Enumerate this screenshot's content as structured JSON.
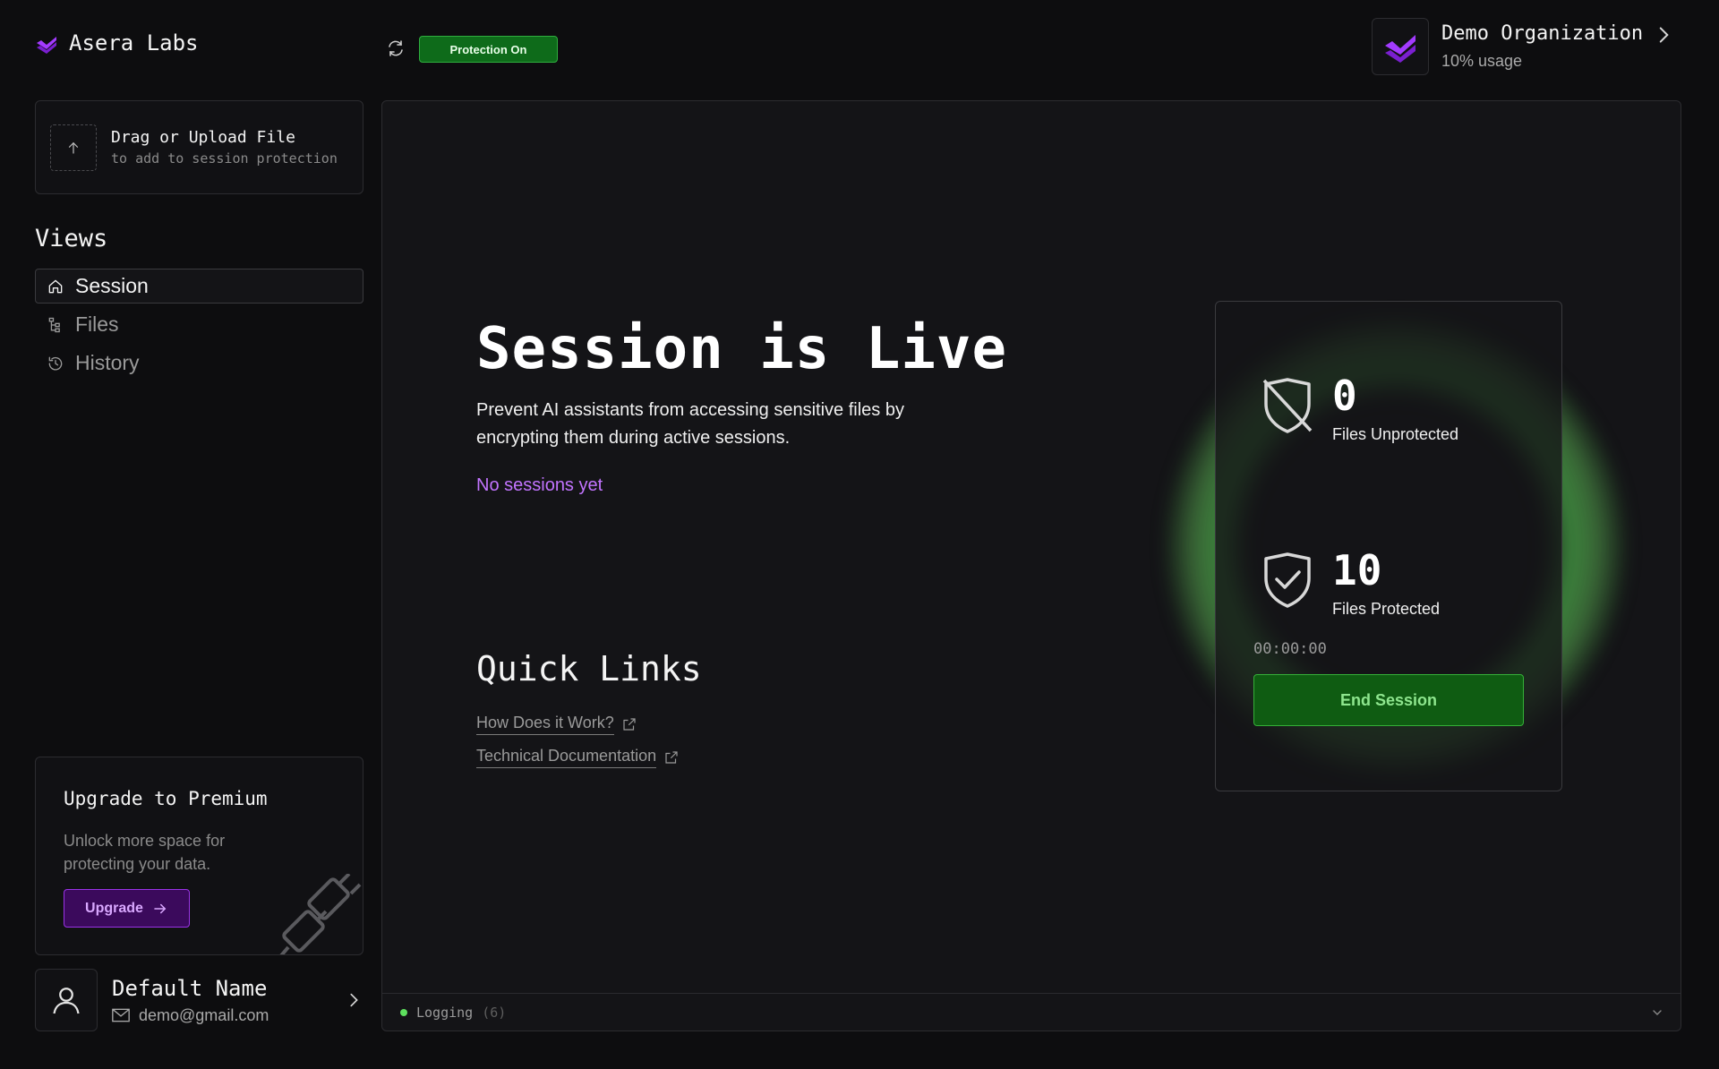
{
  "brand": {
    "name": "Asera Labs",
    "accent": "#a33bff"
  },
  "topbar": {
    "status_badge": "Protection On",
    "status_color": "#0e6b1a"
  },
  "org": {
    "name": "Demo Organization",
    "usage": "10% usage"
  },
  "upload": {
    "title": "Drag or Upload File",
    "subtitle": "to add to session protection"
  },
  "sidebar": {
    "views_title": "Views",
    "items": [
      {
        "label": "Session",
        "icon": "home-icon",
        "active": true
      },
      {
        "label": "Files",
        "icon": "file-tree-icon",
        "active": false
      },
      {
        "label": "History",
        "icon": "history-icon",
        "active": false
      }
    ]
  },
  "upgrade": {
    "title": "Upgrade to Premium",
    "description": "Unlock more space for protecting your data.",
    "button_label": "Upgrade"
  },
  "user": {
    "name": "Default Name",
    "email": "demo@gmail.com"
  },
  "main": {
    "headline": "Session is Live",
    "description": "Prevent AI assistants from accessing sensitive files by encrypting them during active sessions.",
    "no_sessions": "No sessions yet",
    "quick_links_title": "Quick Links",
    "links": [
      {
        "label": "How Does it Work?"
      },
      {
        "label": "Technical Documentation"
      }
    ]
  },
  "session_card": {
    "unprotected_count": "0",
    "unprotected_label": "Files Unprotected",
    "protected_count": "10",
    "protected_label": "Files Protected",
    "timer": "00:00:00",
    "end_button": "End Session",
    "glow_color": "#4a9a4a"
  },
  "logging": {
    "label": "Logging",
    "count": "(6)"
  }
}
